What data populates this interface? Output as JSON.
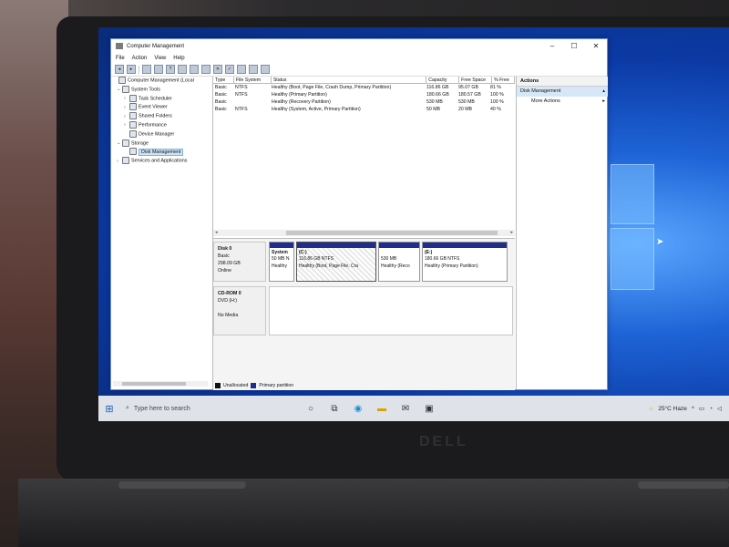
{
  "window": {
    "title": "Computer Management",
    "controls": {
      "minimize": "–",
      "maximize": "☐",
      "close": "✕"
    }
  },
  "menu": [
    "File",
    "Action",
    "View",
    "Help"
  ],
  "tree": [
    {
      "label": "Computer Management (Local",
      "arrow": "",
      "indent": 0
    },
    {
      "label": "System Tools",
      "arrow": "⌄",
      "indent": 1
    },
    {
      "label": "Task Scheduler",
      "arrow": "›",
      "indent": 2
    },
    {
      "label": "Event Viewer",
      "arrow": "›",
      "indent": 2
    },
    {
      "label": "Shared Folders",
      "arrow": "›",
      "indent": 2
    },
    {
      "label": "Performance",
      "arrow": "›",
      "indent": 2
    },
    {
      "label": "Device Manager",
      "arrow": "",
      "indent": 2
    },
    {
      "label": "Storage",
      "arrow": "⌄",
      "indent": 1
    },
    {
      "label": "Disk Management",
      "arrow": "",
      "indent": 2,
      "selected": true
    },
    {
      "label": "Services and Applications",
      "arrow": "›",
      "indent": 1
    }
  ],
  "volumes": {
    "headers": [
      "Type",
      "File System",
      "Status",
      "Capacity",
      "Free Space",
      "% Free"
    ],
    "rows": [
      [
        "Basic",
        "NTFS",
        "Healthy (Boot, Page File, Crash Dump, Primary Partition)",
        "116.86 GB",
        "95.07 GB",
        "81 %"
      ],
      [
        "Basic",
        "NTFS",
        "Healthy (Primary Partition)",
        "180.66 GB",
        "180.57 GB",
        "100 %"
      ],
      [
        "Basic",
        "",
        "Healthy (Recovery Partition)",
        "530 MB",
        "530 MB",
        "100 %"
      ],
      [
        "Basic",
        "NTFS",
        "Healthy (System, Active, Primary Partition)",
        "50 MB",
        "20 MB",
        "40 %"
      ]
    ]
  },
  "disk0": {
    "name": "Disk 0",
    "type": "Basic",
    "size": "298.09 GB",
    "status": "Online",
    "partitions": [
      {
        "title": "System",
        "line2": "50 MB N",
        "line3": "Healthy"
      },
      {
        "title": "(C:)",
        "line2": "116.86 GB NTFS",
        "line3": "Healthy (Boot, Page File, Cra"
      },
      {
        "title": "",
        "line2": "530 MB",
        "line3": "Healthy (Reco"
      },
      {
        "title": "(E:)",
        "line2": "180.66 GB NTFS",
        "line3": "Healthy (Primary Partition)"
      }
    ]
  },
  "cdrom": {
    "name": "CD-ROM 0",
    "type": "DVD (H:)",
    "media": "No Media"
  },
  "legend": {
    "unallocated": "Unallocated",
    "primary": "Primary partition"
  },
  "colors": {
    "unallocated": "#111111",
    "primary": "#1f2e8c"
  },
  "actions": {
    "header": "Actions",
    "selected": "Disk Management",
    "more": "More Actions"
  },
  "taskbar": {
    "search_placeholder": "Type here to search",
    "weather": "25°C  Haze",
    "tray_chevron": "^"
  },
  "brand": "DELL"
}
